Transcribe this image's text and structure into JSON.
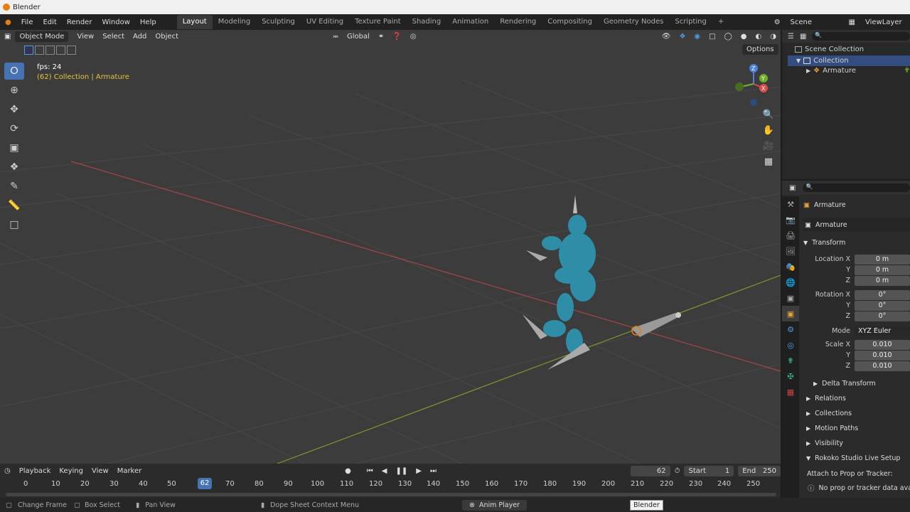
{
  "window": {
    "title": "Blender"
  },
  "menus": [
    "File",
    "Edit",
    "Render",
    "Window",
    "Help"
  ],
  "workspaces": [
    {
      "label": "Layout",
      "active": true
    },
    {
      "label": "Modeling"
    },
    {
      "label": "Sculpting"
    },
    {
      "label": "UV Editing"
    },
    {
      "label": "Texture Paint"
    },
    {
      "label": "Shading"
    },
    {
      "label": "Animation"
    },
    {
      "label": "Rendering"
    },
    {
      "label": "Compositing"
    },
    {
      "label": "Geometry Nodes"
    },
    {
      "label": "Scripting"
    }
  ],
  "add_workspace": "+",
  "scene": {
    "label": "Scene",
    "view_layer": "ViewLayer"
  },
  "viewport": {
    "mode": "Object Mode",
    "menus": [
      "View",
      "Select",
      "Add",
      "Object"
    ],
    "transform_orientation": "Global",
    "options": "Options",
    "fps": "fps: 24",
    "collection_info": "(62) Collection | Armature",
    "gizmo": {
      "x": "X",
      "y": "Y",
      "z": "Z"
    }
  },
  "outliner": {
    "items": [
      {
        "label": "Scene Collection"
      },
      {
        "label": "Collection"
      },
      {
        "label": "Armature"
      }
    ]
  },
  "properties": {
    "object_name": "Armature",
    "object_field": "Armature",
    "transform": {
      "title": "Transform",
      "location": {
        "label": "Location X",
        "x": "0 m",
        "y": "0 m",
        "z": "0 m"
      },
      "rotation": {
        "label": "Rotation X",
        "x": "0°",
        "y": "0°",
        "z": "0°"
      },
      "mode": {
        "label": "Mode",
        "value": "XYZ Euler"
      },
      "scale": {
        "label": "Scale X",
        "x": "0.010",
        "y": "0.010",
        "z": "0.010"
      },
      "y_label": "Y",
      "z_label": "Z"
    },
    "panels": [
      "Delta Transform",
      "Relations",
      "Collections",
      "Motion Paths",
      "Visibility"
    ],
    "rokoko": {
      "title": "Rokoko Studio Live Setup",
      "attach": "Attach to Prop or Tracker:",
      "no_data": "No prop or tracker data availa"
    }
  },
  "timeline": {
    "menus": [
      "Playback",
      "Keying",
      "View",
      "Marker"
    ],
    "current_frame": "62",
    "start_label": "Start",
    "start": "1",
    "end_label": "End",
    "end": "250",
    "ruler": [
      "0",
      "10",
      "20",
      "30",
      "40",
      "50",
      "70",
      "80",
      "90",
      "100",
      "110",
      "120",
      "130",
      "140",
      "150",
      "160",
      "170",
      "180",
      "190",
      "200",
      "210",
      "220",
      "230",
      "240",
      "250"
    ],
    "playhead": "62"
  },
  "statusbar": {
    "items": [
      "Change Frame",
      "Box Select",
      "Pan View",
      "Dope Sheet Context Menu"
    ],
    "anim_player": "Anim Player",
    "tooltip": "Blender"
  }
}
